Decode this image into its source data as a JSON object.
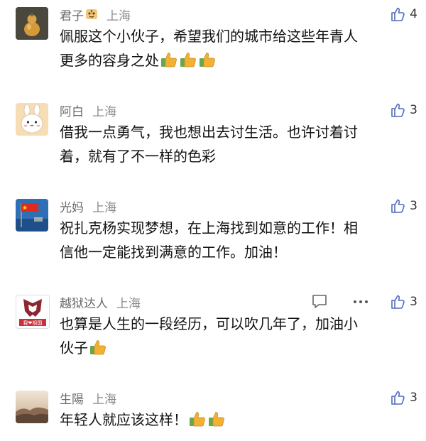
{
  "colors": {
    "text": "#111111",
    "meta": "#6d6d6d",
    "like_icon": "#4f6bbd",
    "thumb_emoji": "#f2b135",
    "thumb_cuff": "#69a84a"
  },
  "comments": [
    {
      "name": "君子",
      "has_badge": true,
      "location": "上海",
      "likes": "4",
      "line1": "佩服这个小伙子，希望我们的城市给这些年青人",
      "line2": "更多的容身之处",
      "thumbs": 3,
      "avatar": "gourd-avatar"
    },
    {
      "name": "阿白",
      "has_badge": false,
      "location": "上海",
      "likes": "3",
      "line1": "借我一点勇气，我也想出去讨生活。也许讨着讨",
      "line2": "着，就有了不一样的色彩",
      "thumbs": 0,
      "avatar": "bunny-avatar"
    },
    {
      "name": "光妈",
      "has_badge": false,
      "location": "上海",
      "likes": "3",
      "line1": "祝扎克杨实现梦想，在上海找到如意的工作！相",
      "line2": "信他一定能找到满意的工作。加油！",
      "thumbs": 0,
      "avatar": "flag-avatar"
    },
    {
      "name": "越狱达人",
      "has_badge": false,
      "location": "上海",
      "likes": "3",
      "line1": "也算是人生的一段经历，可以吹几年了，加油小",
      "line2": "伙子",
      "thumbs": 1,
      "avatar": "decepticon-avatar",
      "avatar_text": "我❤祖国",
      "show_tools": true
    },
    {
      "name": "生陽",
      "has_badge": false,
      "location": "上海",
      "likes": "3",
      "line1": "年轻人就应该这样！",
      "line2": "",
      "thumbs": 2,
      "avatar": "landscape-avatar"
    }
  ]
}
